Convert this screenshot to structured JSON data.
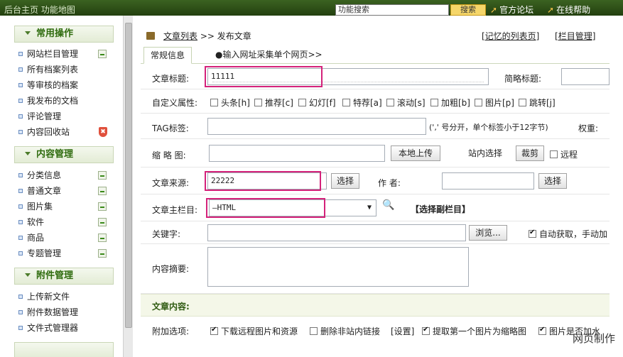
{
  "topbar": {
    "left_text": "后台主页   功能地图",
    "search_placeholder": "功能搜索",
    "search_button": "搜索",
    "link_forum": "官方论坛",
    "link_help": "在线帮助"
  },
  "sidebar": {
    "groups": [
      {
        "title": "常用操作",
        "items": [
          "网站栏目管理",
          "所有档案列表",
          "等审核的档案",
          "我发布的文档",
          "评论管理",
          "内容回收站"
        ]
      },
      {
        "title": "内容管理",
        "items": [
          "分类信息",
          "普通文章",
          "图片集",
          "软件",
          "商品",
          "专题管理"
        ]
      },
      {
        "title": "附件管理",
        "items": [
          "上传新文件",
          "附件数据管理",
          "文件式管理器"
        ]
      }
    ]
  },
  "breadcrumb": {
    "list": "文章列表",
    "sep": ">>",
    "current": "发布文章"
  },
  "top_links": {
    "remember": "[记忆的列表页]",
    "column": "[栏目管理]"
  },
  "tabs": {
    "general": "常规信息",
    "collect": "●输入网址采集单个网页>>"
  },
  "form": {
    "title_label": "文章标题:",
    "title_value": "11111",
    "short_title_label": "简略标题:",
    "custom_attr_label": "自定义属性:",
    "attrs": [
      "头条[h]",
      "推荐[c]",
      "幻灯[f]",
      "特荐[a]",
      "滚动[s]",
      "加粗[b]",
      "图片[p]",
      "跳转[j]"
    ],
    "tag_label": "TAG标签:",
    "tag_hint": "(',' 号分开，单个标签小于12字节)",
    "weight_label": "权重:",
    "thumb_label": "缩 略 图:",
    "local_upload": "本地上传",
    "site_select": "站内选择",
    "crop": "裁剪",
    "remote": "远程",
    "source_label": "文章来源:",
    "source_value": "22222",
    "select_btn": "选择",
    "author_label": "作   者:",
    "author_select_btn": "选择",
    "column_label": "文章主栏目:",
    "column_value": "—HTML",
    "select_sub_column": "【选择副栏目】",
    "keyword_label": "关键字:",
    "browse": "浏览...",
    "auto_fetch": "自动获取，手动加",
    "summary_label": "内容摘要:",
    "content_section": "文章内容:",
    "extra_label": "附加选项:",
    "extra_download": "下载远程图片和资源",
    "extra_delete_links": "删除非站内链接",
    "extra_settings": "[设置]",
    "extra_first_pic": "提取第一个图片为缩略图",
    "extra_pic_add": "图片是否加水"
  },
  "watermark": "网页制作"
}
